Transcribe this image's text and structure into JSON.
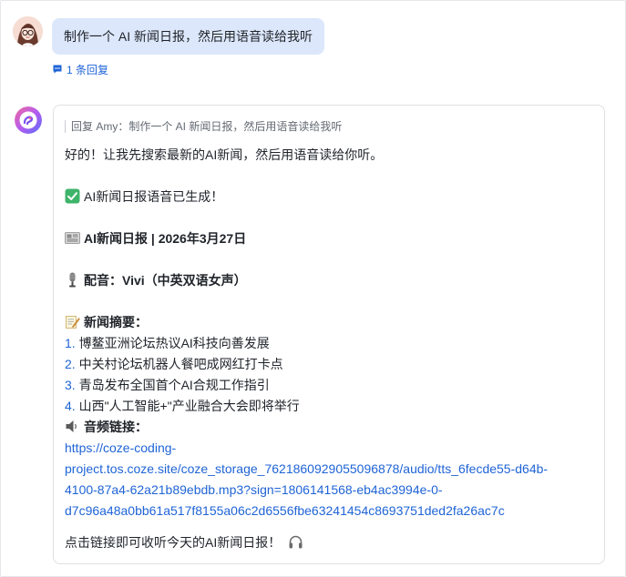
{
  "user_message": {
    "text": "制作一个 AI 新闻日报，然后用语音读给我听",
    "reply_count_label": "1 条回复"
  },
  "bot_message": {
    "quote": "回复 Amy：制作一个 AI 新闻日报，然后用语音读给我听",
    "intro": "好的！让我先搜索最新的AI新闻，然后用语音读给你听。",
    "generated_status": "AI新闻日报语音已生成！",
    "title": "AI新闻日报 | 2026年3月27日",
    "voice": "配音：Vivi（中英双语女声）",
    "summary_heading": "新闻摘要：",
    "news_items": [
      {
        "num": "1.",
        "text": "博鳌亚洲论坛热议AI科技向善发展"
      },
      {
        "num": "2.",
        "text": "中关村论坛机器人餐吧成网红打卡点"
      },
      {
        "num": "3.",
        "text": "青岛发布全国首个AI合规工作指引"
      },
      {
        "num": "4.",
        "text": "山西\"人工智能+\"产业融合大会即将举行"
      }
    ],
    "audio_heading": "音频链接：",
    "audio_link_lines": [
      "https://coze-coding-",
      "project.tos.coze.site/coze_storage_7621860929055096878/audio/tts_6fecde55-d64b-",
      "4100-87a4-62a21b89ebdb.mp3?sign=1806141568-eb4ac3994e-0-",
      "d7c96a48a0bb61a517f8155a06c2d6556fbe63241454c8693751ded2fa26ac7c"
    ],
    "closing": "点击链接即可收听今天的AI新闻日报！"
  },
  "icons": {
    "check": "check-mark-button-icon",
    "newspaper": "newspaper-icon",
    "microphone": "microphone-icon",
    "memo": "memo-icon",
    "speaker": "speaker-icon",
    "headphones": "headphones-icon"
  },
  "colors": {
    "accent": "#1f64d6",
    "user_bubble": "#dce7fb",
    "check_green": "#3eb46a"
  }
}
